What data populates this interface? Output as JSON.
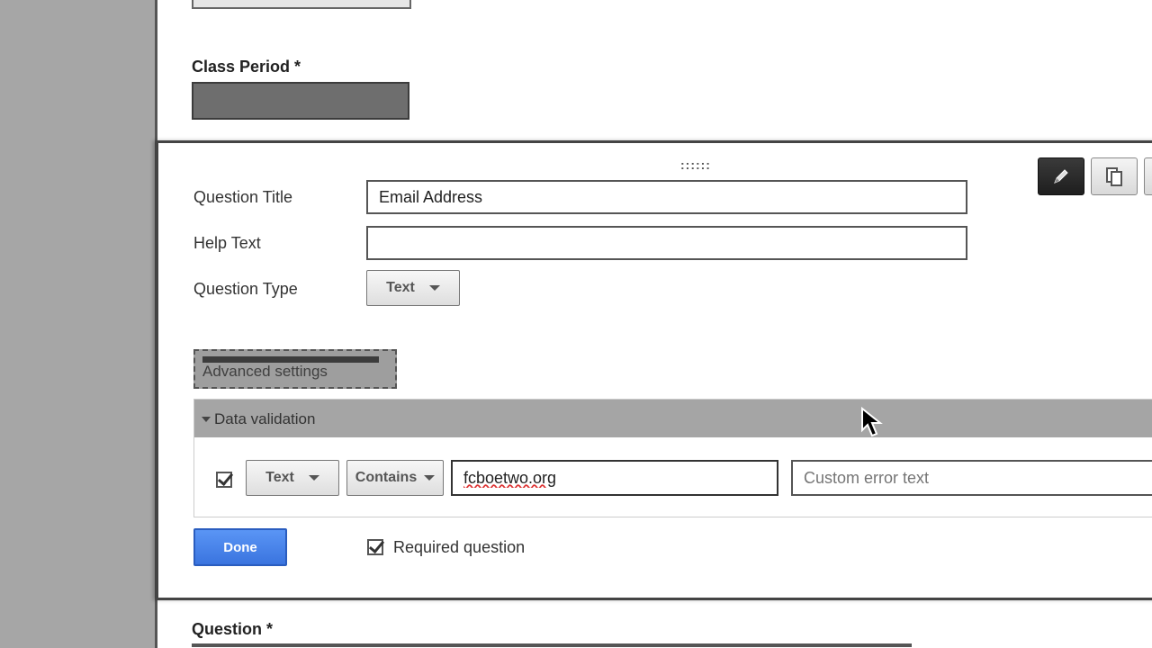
{
  "above_form": {
    "class_period_label": "Class Period *"
  },
  "editor": {
    "drag_handle": "::::::",
    "toolbar": {
      "edit_icon": "pencil-icon",
      "duplicate_icon": "duplicate-icon",
      "delete_icon": "trash-icon"
    },
    "question_title_label": "Question Title",
    "question_title_value": "Email Address",
    "help_text_label": "Help Text",
    "help_text_value": "",
    "question_type_label": "Question Type",
    "question_type_value": "Text",
    "advanced_settings_label": "Advanced settings",
    "validation": {
      "header": "Data validation",
      "type_value": "Text",
      "condition_value": "Contains",
      "pattern_value": "fcboetwo.org",
      "error_placeholder": "Custom error text",
      "enabled": true
    },
    "done_label": "Done",
    "required_label": "Required question",
    "required_checked": true
  },
  "below_form": {
    "question_label": "Question *"
  },
  "colors": {
    "done_button": "#3a74df",
    "header_gray": "#a5a5a5",
    "active_toolbar": "#1e1e1e"
  }
}
